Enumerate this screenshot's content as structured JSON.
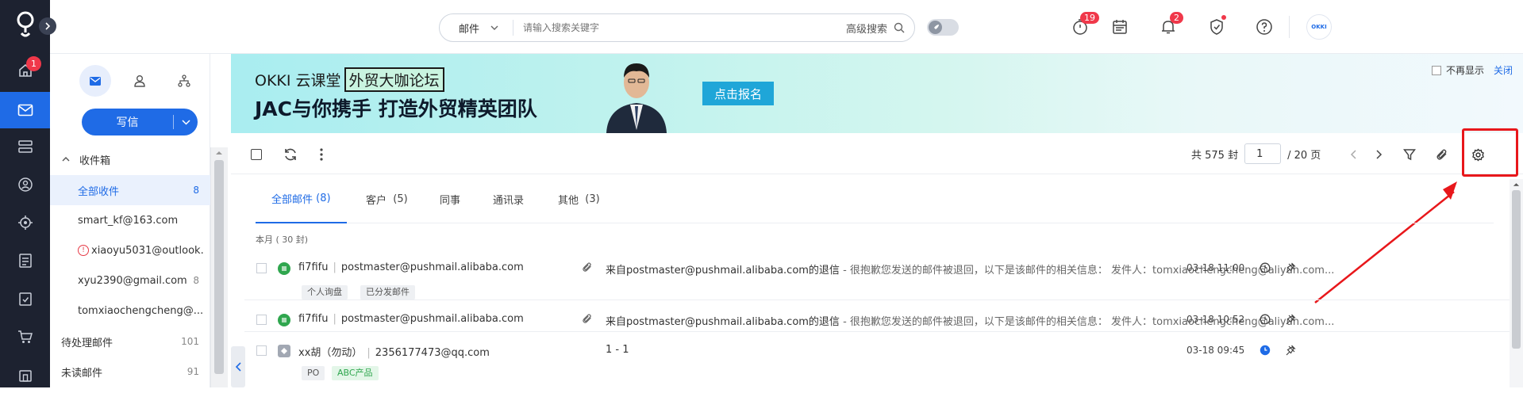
{
  "rail": {
    "home_badge": "1"
  },
  "topbar": {
    "search_type": "邮件",
    "search_placeholder": "请输入搜索关键字",
    "advanced_search": "高级搜索",
    "task_badge": "19",
    "notify_badge": "2",
    "avatar_text": "OKKI"
  },
  "sidebar": {
    "compose_label": "写信",
    "inbox_label": "收件箱",
    "folders": [
      {
        "label": "全部收件",
        "count": "8"
      },
      {
        "label": "smart_kf@163.com",
        "count": ""
      },
      {
        "label": "xiaoyu5031@outlook.",
        "count": ""
      },
      {
        "label": "xyu2390@gmail.com",
        "count": "8"
      },
      {
        "label": "tomxiaochengcheng@...",
        "count": ""
      },
      {
        "label": "待处理邮件",
        "count": "101"
      },
      {
        "label": "未读邮件",
        "count": "91"
      }
    ]
  },
  "banner": {
    "brand": "OKKI 云课堂",
    "highlight": "外贸大咖论坛",
    "headline": "JAC与你携手 打造外贸精英团队",
    "cta": "点击报名",
    "dont_show": "不再显示",
    "close": "关闭"
  },
  "toolbar": {
    "total": "共 575 封",
    "page_value": "1",
    "page_total": "/ 20 页"
  },
  "tabs": [
    {
      "label": "全部邮件",
      "count": "(8)"
    },
    {
      "label": "客户",
      "count": "(5)"
    },
    {
      "label": "同事",
      "count": ""
    },
    {
      "label": "通讯录",
      "count": ""
    },
    {
      "label": "其他",
      "count": "(3)"
    }
  ],
  "list": {
    "month_header": "本月 ( 30 封)",
    "emails": [
      {
        "sender_name": "fi7fifu",
        "sender_email": "postmaster@pushmail.alibaba.com",
        "subject": "来自postmaster@pushmail.alibaba.com的退信",
        "preview": " - 很抱歉您发送的邮件被退回，以下是该邮件的相关信息： 发件人：tomxiaochengcheng@aliyun.com...",
        "date": "03-18 11:00",
        "tags": [
          "个人询盘",
          "已分发邮件"
        ]
      },
      {
        "sender_name": "fi7fifu",
        "sender_email": "postmaster@pushmail.alibaba.com",
        "subject": "来自postmaster@pushmail.alibaba.com的退信",
        "preview": " - 很抱歉您发送的邮件被退回，以下是该邮件的相关信息： 发件人：tomxiaochengcheng@aliyun.com...",
        "date": "03-18 10:52",
        "tags": []
      },
      {
        "sender_name": "xx胡（勿动）",
        "sender_email": "2356177473@qq.com",
        "subject": "1 - 1",
        "preview": "",
        "date": "03-18 09:45",
        "tags": [
          "PO",
          "ABC产品"
        ]
      }
    ]
  },
  "colors": {
    "accent": "#1f6be6",
    "rail": "#1d2230",
    "badge": "#f0384a",
    "highlight_box": "#e8171b"
  }
}
